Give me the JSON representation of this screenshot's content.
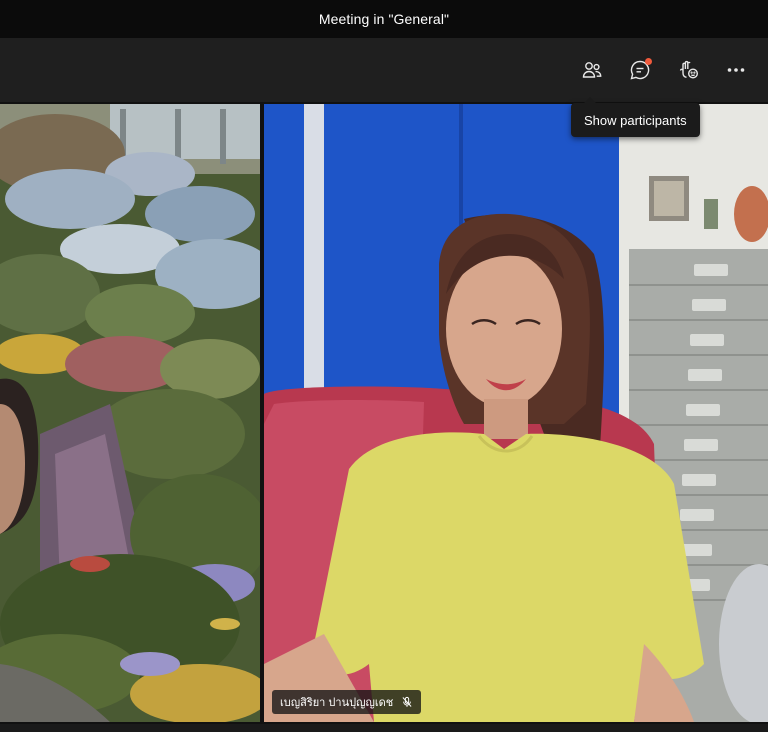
{
  "window": {
    "title": "Meeting in \"General\""
  },
  "toolbar": {
    "buttons": [
      {
        "icon": "participants-icon",
        "label": "Show participants"
      },
      {
        "icon": "chat-icon",
        "label": "Show conversation",
        "badge": true
      },
      {
        "icon": "reactions-icon",
        "label": "Reactions"
      },
      {
        "icon": "more-options-icon",
        "label": "More actions"
      }
    ]
  },
  "tooltip": {
    "text": "Show participants"
  },
  "participants": {
    "left": {
      "name": ""
    },
    "right": {
      "name": "เบญสิริยา ปานปุญญเดช",
      "muted": true
    }
  },
  "colors": {
    "badge": "#f05a3c",
    "titlebar": "#0b0b0b",
    "toolbar": "#1f1f1f"
  }
}
